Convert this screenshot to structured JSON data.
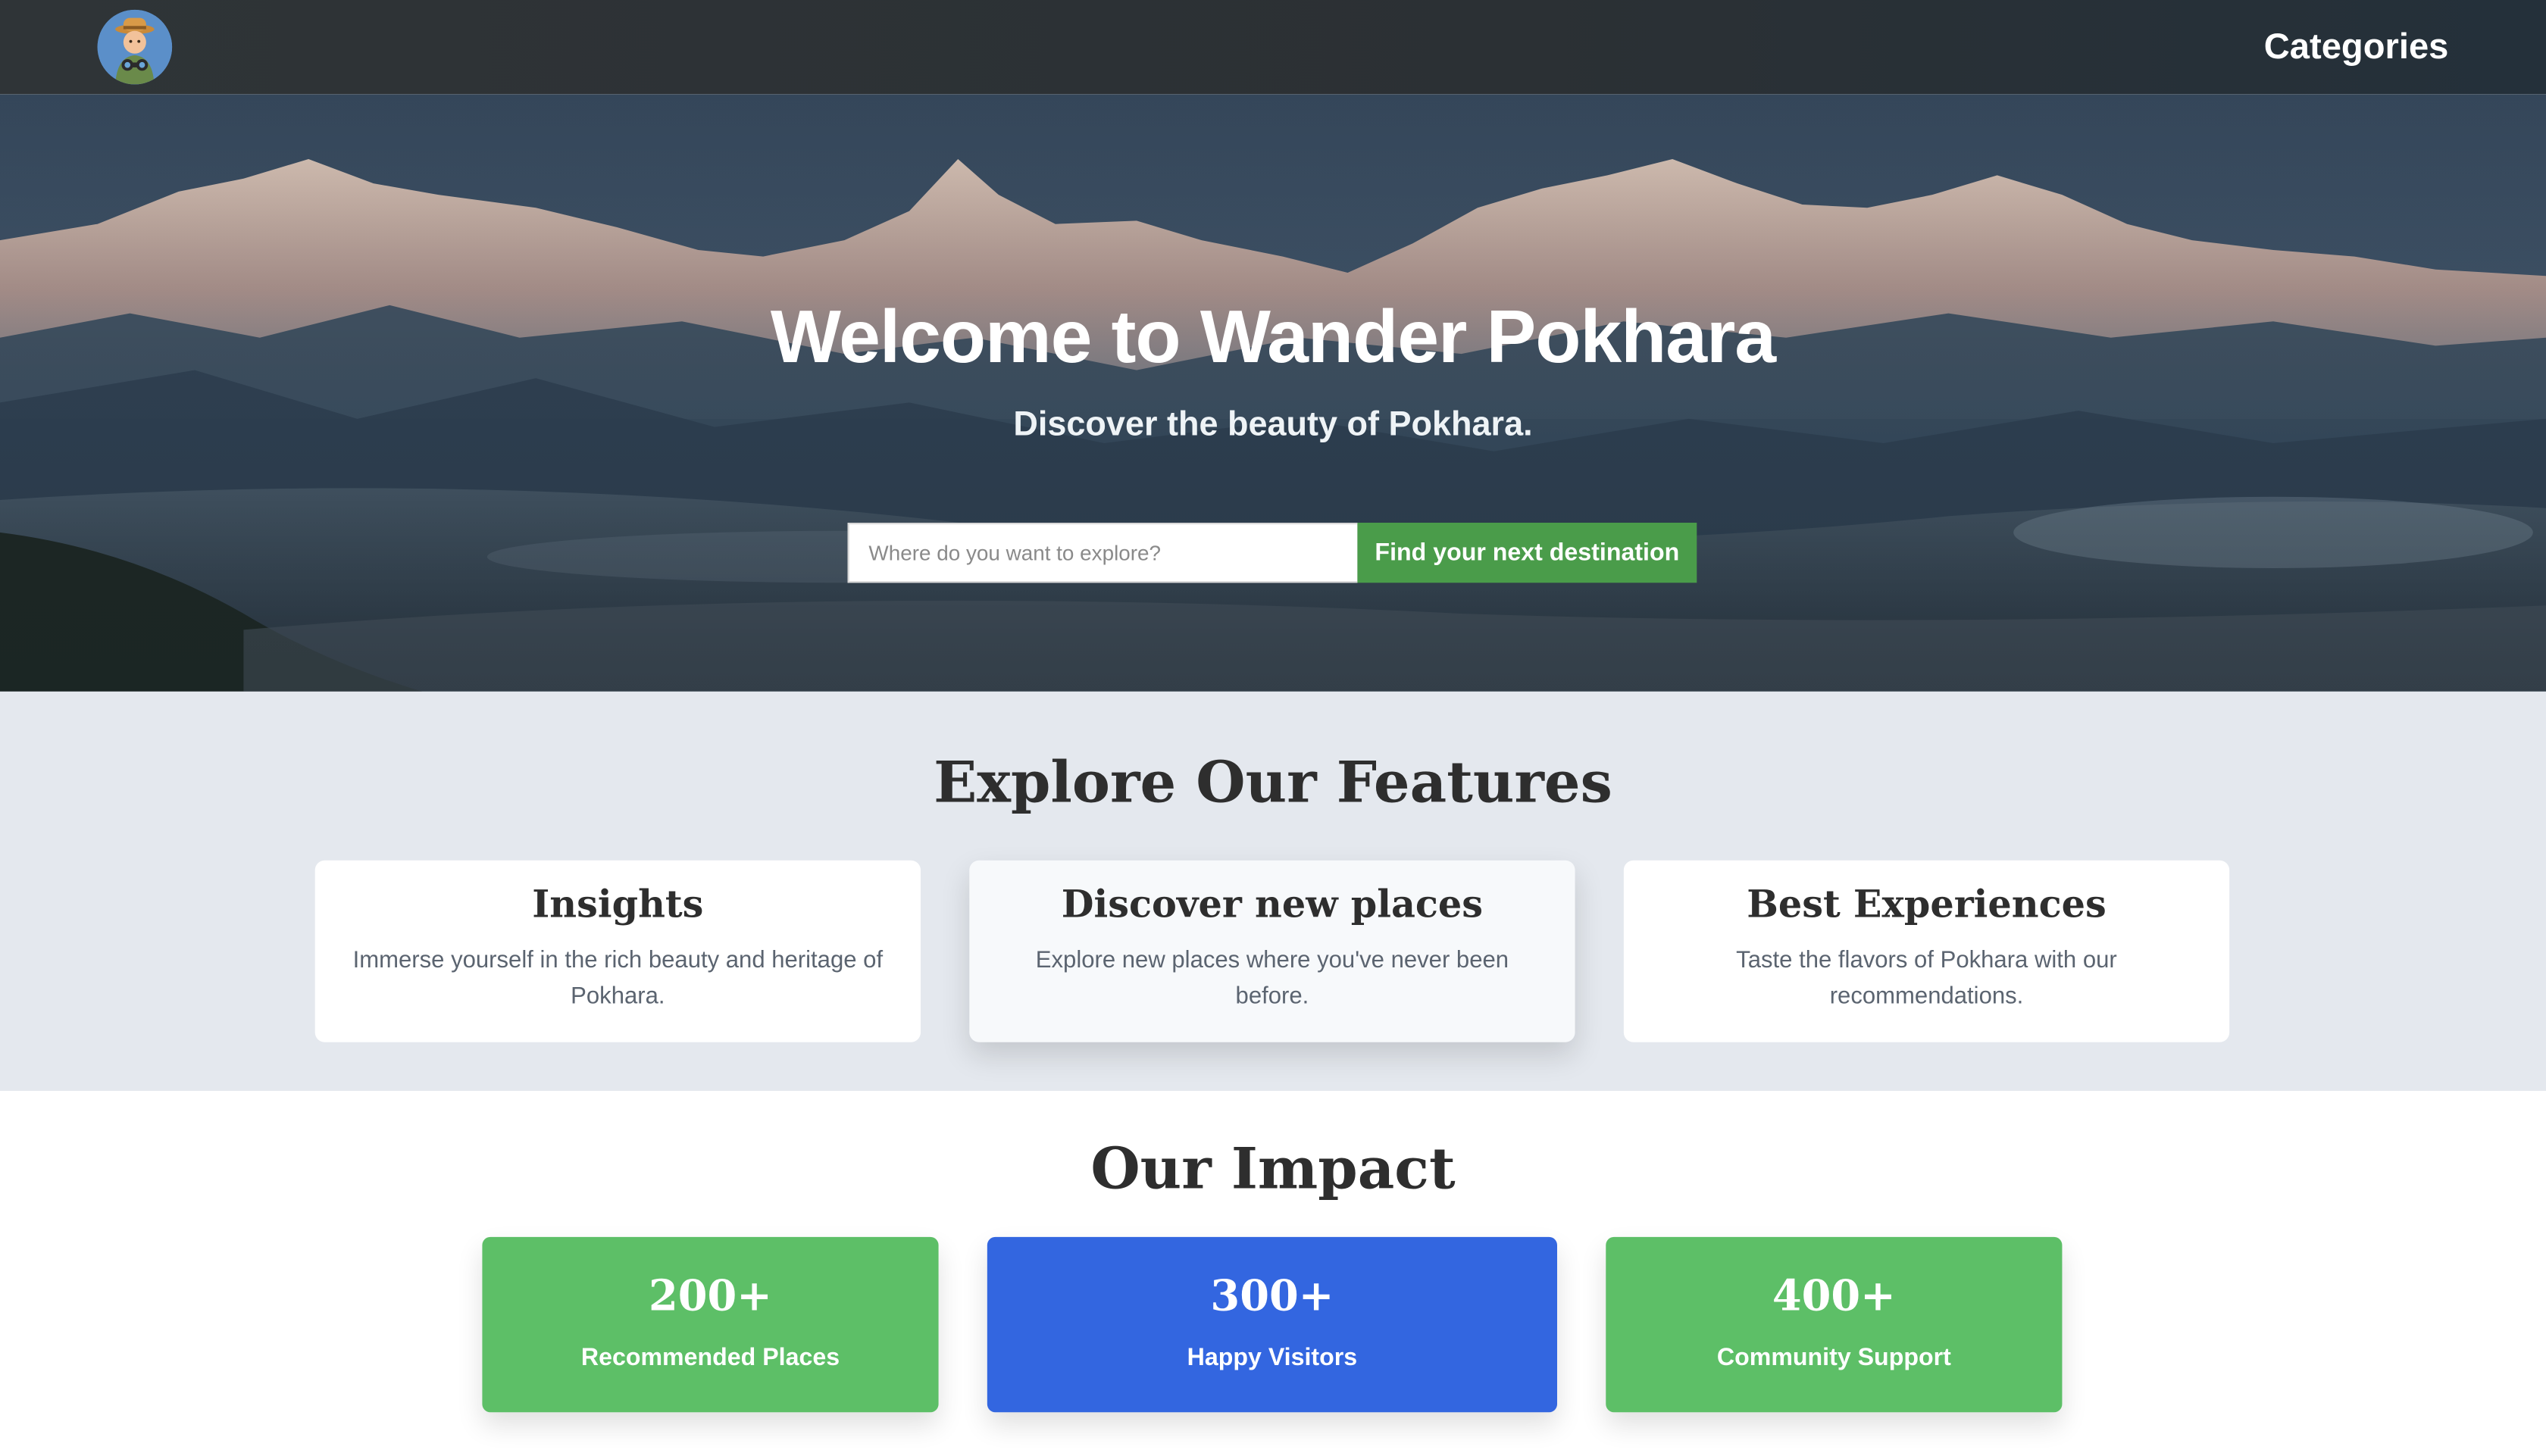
{
  "navbar": {
    "logo_icon": "explorer-avatar-icon",
    "categories_label": "Categories"
  },
  "hero": {
    "title": "Welcome to Wander Pokhara",
    "subtitle": "Discover the beauty of Pokhara.",
    "search_placeholder": "Where do you want to explore?",
    "search_value": "",
    "search_button_label": "Find your next destination",
    "colors": {
      "button": "#4a9c4a"
    }
  },
  "features": {
    "title": "Explore Our Features",
    "cards": [
      {
        "title": "Insights",
        "text": "Immerse yourself in the rich beauty and heritage of Pokhara."
      },
      {
        "title": "Discover new places",
        "text": "Explore new places where you've never been before."
      },
      {
        "title": "Best Experiences",
        "text": "Taste the flavors of Pokhara with our recommendations."
      }
    ]
  },
  "impact": {
    "title": "Our Impact",
    "stats": [
      {
        "value": "200+",
        "label": "Recommended Places",
        "color": "#5dbf67"
      },
      {
        "value": "300+",
        "label": "Happy Visitors",
        "color": "#3366e0"
      },
      {
        "value": "400+",
        "label": "Community Support",
        "color": "#5dbf67"
      }
    ]
  }
}
